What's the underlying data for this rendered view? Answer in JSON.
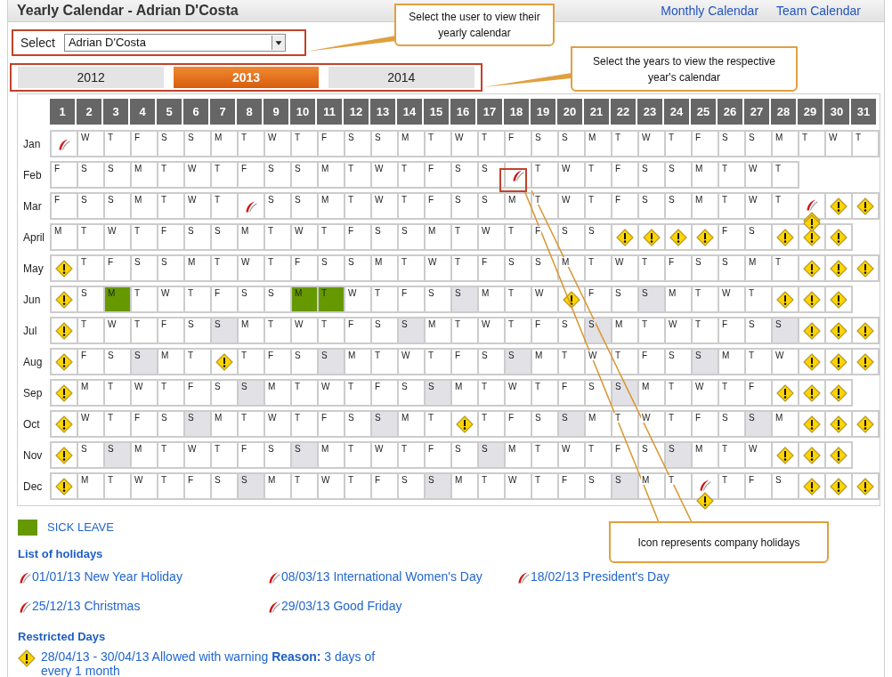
{
  "header": {
    "title": "Yearly Calendar - Adrian D'Costa",
    "links": [
      "Monthly Calendar",
      "Team Calendar"
    ]
  },
  "user_select": {
    "label": "Select",
    "value": "Adrian D'Costa"
  },
  "year_tabs": [
    {
      "label": "2012",
      "selected": false
    },
    {
      "label": "2013",
      "selected": true
    },
    {
      "label": "2014",
      "selected": false
    }
  ],
  "day_numbers": [
    "1",
    "2",
    "3",
    "4",
    "5",
    "6",
    "7",
    "8",
    "9",
    "10",
    "11",
    "12",
    "13",
    "14",
    "15",
    "16",
    "17",
    "18",
    "19",
    "20",
    "21",
    "22",
    "23",
    "24",
    "25",
    "26",
    "27",
    "28",
    "29",
    "30",
    "31"
  ],
  "months": [
    {
      "name": "Jan",
      "days": [
        {
          "kind": "holiday"
        },
        {
          "kind": "day",
          "label": "W"
        },
        {
          "kind": "day",
          "label": "T"
        },
        {
          "kind": "day",
          "label": "F"
        },
        {
          "kind": "day",
          "label": "S"
        },
        {
          "kind": "day",
          "label": "S"
        },
        {
          "kind": "day",
          "label": "M"
        },
        {
          "kind": "day",
          "label": "T"
        },
        {
          "kind": "day",
          "label": "W"
        },
        {
          "kind": "day",
          "label": "T"
        },
        {
          "kind": "day",
          "label": "F"
        },
        {
          "kind": "day",
          "label": "S"
        },
        {
          "kind": "day",
          "label": "S"
        },
        {
          "kind": "day",
          "label": "M"
        },
        {
          "kind": "day",
          "label": "T"
        },
        {
          "kind": "day",
          "label": "W"
        },
        {
          "kind": "day",
          "label": "T"
        },
        {
          "kind": "day",
          "label": "F"
        },
        {
          "kind": "day",
          "label": "S"
        },
        {
          "kind": "day",
          "label": "S"
        },
        {
          "kind": "day",
          "label": "M"
        },
        {
          "kind": "day",
          "label": "T"
        },
        {
          "kind": "day",
          "label": "W"
        },
        {
          "kind": "day",
          "label": "T"
        },
        {
          "kind": "day",
          "label": "F"
        },
        {
          "kind": "day",
          "label": "S"
        },
        {
          "kind": "day",
          "label": "S"
        },
        {
          "kind": "day",
          "label": "M"
        },
        {
          "kind": "day",
          "label": "T"
        },
        {
          "kind": "day",
          "label": "W"
        },
        {
          "kind": "day",
          "label": "T"
        }
      ]
    },
    {
      "name": "Feb",
      "days": [
        {
          "kind": "day",
          "label": "F"
        },
        {
          "kind": "day",
          "label": "S"
        },
        {
          "kind": "day",
          "label": "S"
        },
        {
          "kind": "day",
          "label": "M"
        },
        {
          "kind": "day",
          "label": "T"
        },
        {
          "kind": "day",
          "label": "W"
        },
        {
          "kind": "day",
          "label": "T"
        },
        {
          "kind": "day",
          "label": "F"
        },
        {
          "kind": "day",
          "label": "S"
        },
        {
          "kind": "day",
          "label": "S"
        },
        {
          "kind": "day",
          "label": "M"
        },
        {
          "kind": "day",
          "label": "T"
        },
        {
          "kind": "day",
          "label": "W"
        },
        {
          "kind": "day",
          "label": "T"
        },
        {
          "kind": "day",
          "label": "F"
        },
        {
          "kind": "day",
          "label": "S"
        },
        {
          "kind": "day",
          "label": "S"
        },
        {
          "kind": "holiday"
        },
        {
          "kind": "day",
          "label": "T"
        },
        {
          "kind": "day",
          "label": "W"
        },
        {
          "kind": "day",
          "label": "T"
        },
        {
          "kind": "day",
          "label": "F"
        },
        {
          "kind": "day",
          "label": "S"
        },
        {
          "kind": "day",
          "label": "S"
        },
        {
          "kind": "day",
          "label": "M"
        },
        {
          "kind": "day",
          "label": "T"
        },
        {
          "kind": "day",
          "label": "W"
        },
        {
          "kind": "day",
          "label": "T"
        }
      ]
    },
    {
      "name": "Mar",
      "days": [
        {
          "kind": "day",
          "label": "F"
        },
        {
          "kind": "day",
          "label": "S"
        },
        {
          "kind": "day",
          "label": "S"
        },
        {
          "kind": "day",
          "label": "M"
        },
        {
          "kind": "day",
          "label": "T"
        },
        {
          "kind": "day",
          "label": "W"
        },
        {
          "kind": "day",
          "label": "T"
        },
        {
          "kind": "holiday"
        },
        {
          "kind": "day",
          "label": "S"
        },
        {
          "kind": "day",
          "label": "S"
        },
        {
          "kind": "day",
          "label": "M"
        },
        {
          "kind": "day",
          "label": "T"
        },
        {
          "kind": "day",
          "label": "W"
        },
        {
          "kind": "day",
          "label": "T"
        },
        {
          "kind": "day",
          "label": "F"
        },
        {
          "kind": "day",
          "label": "S"
        },
        {
          "kind": "day",
          "label": "S"
        },
        {
          "kind": "day",
          "label": "M"
        },
        {
          "kind": "day",
          "label": "T"
        },
        {
          "kind": "day",
          "label": "W"
        },
        {
          "kind": "day",
          "label": "T"
        },
        {
          "kind": "day",
          "label": "F"
        },
        {
          "kind": "day",
          "label": "S"
        },
        {
          "kind": "day",
          "label": "S"
        },
        {
          "kind": "day",
          "label": "M"
        },
        {
          "kind": "day",
          "label": "T"
        },
        {
          "kind": "day",
          "label": "W"
        },
        {
          "kind": "day",
          "label": "T"
        },
        {
          "kind": "holiday_warning"
        },
        {
          "kind": "warning"
        },
        {
          "kind": "warning"
        }
      ]
    },
    {
      "name": "April",
      "days": [
        {
          "kind": "day",
          "label": "M"
        },
        {
          "kind": "day",
          "label": "T"
        },
        {
          "kind": "day",
          "label": "W"
        },
        {
          "kind": "day",
          "label": "T"
        },
        {
          "kind": "day",
          "label": "F"
        },
        {
          "kind": "day",
          "label": "S"
        },
        {
          "kind": "day",
          "label": "S"
        },
        {
          "kind": "day",
          "label": "M"
        },
        {
          "kind": "day",
          "label": "T"
        },
        {
          "kind": "day",
          "label": "W"
        },
        {
          "kind": "day",
          "label": "T"
        },
        {
          "kind": "day",
          "label": "F"
        },
        {
          "kind": "day",
          "label": "S"
        },
        {
          "kind": "day",
          "label": "S"
        },
        {
          "kind": "day",
          "label": "M"
        },
        {
          "kind": "day",
          "label": "T"
        },
        {
          "kind": "day",
          "label": "W"
        },
        {
          "kind": "day",
          "label": "T"
        },
        {
          "kind": "day",
          "label": "F"
        },
        {
          "kind": "day",
          "label": "S"
        },
        {
          "kind": "day",
          "label": "S"
        },
        {
          "kind": "warning"
        },
        {
          "kind": "warning"
        },
        {
          "kind": "warning"
        },
        {
          "kind": "warning"
        },
        {
          "kind": "day",
          "label": "F"
        },
        {
          "kind": "day",
          "label": "S"
        },
        {
          "kind": "warning"
        },
        {
          "kind": "double_warning"
        },
        {
          "kind": "warning"
        }
      ]
    },
    {
      "name": "May",
      "days": [
        {
          "kind": "warning"
        },
        {
          "kind": "day",
          "label": "T"
        },
        {
          "kind": "day",
          "label": "F"
        },
        {
          "kind": "day",
          "label": "S"
        },
        {
          "kind": "day",
          "label": "S"
        },
        {
          "kind": "day",
          "label": "M"
        },
        {
          "kind": "day",
          "label": "T"
        },
        {
          "kind": "day",
          "label": "W"
        },
        {
          "kind": "day",
          "label": "T"
        },
        {
          "kind": "day",
          "label": "F"
        },
        {
          "kind": "day",
          "label": "S"
        },
        {
          "kind": "day",
          "label": "S"
        },
        {
          "kind": "day",
          "label": "M"
        },
        {
          "kind": "day",
          "label": "T"
        },
        {
          "kind": "day",
          "label": "W"
        },
        {
          "kind": "day",
          "label": "T"
        },
        {
          "kind": "day",
          "label": "F"
        },
        {
          "kind": "day",
          "label": "S"
        },
        {
          "kind": "day",
          "label": "S"
        },
        {
          "kind": "day",
          "label": "M"
        },
        {
          "kind": "day",
          "label": "T"
        },
        {
          "kind": "day",
          "label": "W"
        },
        {
          "kind": "day",
          "label": "T"
        },
        {
          "kind": "day",
          "label": "F"
        },
        {
          "kind": "day",
          "label": "S"
        },
        {
          "kind": "day",
          "label": "S"
        },
        {
          "kind": "day",
          "label": "M"
        },
        {
          "kind": "day",
          "label": "T"
        },
        {
          "kind": "warning"
        },
        {
          "kind": "warning"
        },
        {
          "kind": "warning"
        }
      ]
    },
    {
      "name": "Jun",
      "days": [
        {
          "kind": "warning"
        },
        {
          "kind": "day",
          "label": "S"
        },
        {
          "kind": "sick",
          "label": "M"
        },
        {
          "kind": "day",
          "label": "T"
        },
        {
          "kind": "day",
          "label": "W"
        },
        {
          "kind": "day",
          "label": "T"
        },
        {
          "kind": "day",
          "label": "F"
        },
        {
          "kind": "day",
          "label": "S"
        },
        {
          "kind": "day",
          "label": "S"
        },
        {
          "kind": "sick",
          "label": "M"
        },
        {
          "kind": "sick",
          "label": "T"
        },
        {
          "kind": "day",
          "label": "W"
        },
        {
          "kind": "day",
          "label": "T"
        },
        {
          "kind": "day",
          "label": "F"
        },
        {
          "kind": "day",
          "label": "S"
        },
        {
          "kind": "weekend",
          "label": "S"
        },
        {
          "kind": "day",
          "label": "M"
        },
        {
          "kind": "day",
          "label": "T"
        },
        {
          "kind": "day",
          "label": "W"
        },
        {
          "kind": "warning"
        },
        {
          "kind": "day",
          "label": "F"
        },
        {
          "kind": "day",
          "label": "S"
        },
        {
          "kind": "weekend",
          "label": "S"
        },
        {
          "kind": "day",
          "label": "M"
        },
        {
          "kind": "day",
          "label": "T"
        },
        {
          "kind": "day",
          "label": "W"
        },
        {
          "kind": "day",
          "label": "T"
        },
        {
          "kind": "warning"
        },
        {
          "kind": "warning"
        },
        {
          "kind": "warning"
        }
      ]
    },
    {
      "name": "Jul",
      "days": [
        {
          "kind": "warning"
        },
        {
          "kind": "day",
          "label": "T"
        },
        {
          "kind": "day",
          "label": "W"
        },
        {
          "kind": "day",
          "label": "T"
        },
        {
          "kind": "day",
          "label": "F"
        },
        {
          "kind": "day",
          "label": "S"
        },
        {
          "kind": "weekend",
          "label": "S"
        },
        {
          "kind": "day",
          "label": "M"
        },
        {
          "kind": "day",
          "label": "T"
        },
        {
          "kind": "day",
          "label": "W"
        },
        {
          "kind": "day",
          "label": "T"
        },
        {
          "kind": "day",
          "label": "F"
        },
        {
          "kind": "day",
          "label": "S"
        },
        {
          "kind": "weekend",
          "label": "S"
        },
        {
          "kind": "day",
          "label": "M"
        },
        {
          "kind": "day",
          "label": "T"
        },
        {
          "kind": "day",
          "label": "W"
        },
        {
          "kind": "day",
          "label": "T"
        },
        {
          "kind": "day",
          "label": "F"
        },
        {
          "kind": "day",
          "label": "S"
        },
        {
          "kind": "weekend",
          "label": "S"
        },
        {
          "kind": "day",
          "label": "M"
        },
        {
          "kind": "day",
          "label": "T"
        },
        {
          "kind": "day",
          "label": "W"
        },
        {
          "kind": "day",
          "label": "T"
        },
        {
          "kind": "day",
          "label": "F"
        },
        {
          "kind": "day",
          "label": "S"
        },
        {
          "kind": "weekend",
          "label": "S"
        },
        {
          "kind": "warning"
        },
        {
          "kind": "warning"
        },
        {
          "kind": "warning"
        }
      ]
    },
    {
      "name": "Aug",
      "days": [
        {
          "kind": "warning"
        },
        {
          "kind": "day",
          "label": "F"
        },
        {
          "kind": "day",
          "label": "S"
        },
        {
          "kind": "weekend",
          "label": "S"
        },
        {
          "kind": "day",
          "label": "M"
        },
        {
          "kind": "day",
          "label": "T"
        },
        {
          "kind": "warning"
        },
        {
          "kind": "day",
          "label": "T"
        },
        {
          "kind": "day",
          "label": "F"
        },
        {
          "kind": "day",
          "label": "S"
        },
        {
          "kind": "weekend",
          "label": "S"
        },
        {
          "kind": "day",
          "label": "M"
        },
        {
          "kind": "day",
          "label": "T"
        },
        {
          "kind": "day",
          "label": "W"
        },
        {
          "kind": "day",
          "label": "T"
        },
        {
          "kind": "day",
          "label": "F"
        },
        {
          "kind": "day",
          "label": "S"
        },
        {
          "kind": "weekend",
          "label": "S"
        },
        {
          "kind": "day",
          "label": "M"
        },
        {
          "kind": "day",
          "label": "T"
        },
        {
          "kind": "day",
          "label": "W"
        },
        {
          "kind": "day",
          "label": "T"
        },
        {
          "kind": "day",
          "label": "F"
        },
        {
          "kind": "day",
          "label": "S"
        },
        {
          "kind": "weekend",
          "label": "S"
        },
        {
          "kind": "day",
          "label": "M"
        },
        {
          "kind": "day",
          "label": "T"
        },
        {
          "kind": "day",
          "label": "W"
        },
        {
          "kind": "warning"
        },
        {
          "kind": "warning"
        },
        {
          "kind": "warning"
        }
      ]
    },
    {
      "name": "Sep",
      "days": [
        {
          "kind": "warning"
        },
        {
          "kind": "day",
          "label": "M"
        },
        {
          "kind": "day",
          "label": "T"
        },
        {
          "kind": "day",
          "label": "W"
        },
        {
          "kind": "day",
          "label": "T"
        },
        {
          "kind": "day",
          "label": "F"
        },
        {
          "kind": "day",
          "label": "S"
        },
        {
          "kind": "weekend",
          "label": "S"
        },
        {
          "kind": "day",
          "label": "M"
        },
        {
          "kind": "day",
          "label": "T"
        },
        {
          "kind": "day",
          "label": "W"
        },
        {
          "kind": "day",
          "label": "T"
        },
        {
          "kind": "day",
          "label": "F"
        },
        {
          "kind": "day",
          "label": "S"
        },
        {
          "kind": "weekend",
          "label": "S"
        },
        {
          "kind": "day",
          "label": "M"
        },
        {
          "kind": "day",
          "label": "T"
        },
        {
          "kind": "day",
          "label": "W"
        },
        {
          "kind": "day",
          "label": "T"
        },
        {
          "kind": "day",
          "label": "F"
        },
        {
          "kind": "day",
          "label": "S"
        },
        {
          "kind": "weekend",
          "label": "S"
        },
        {
          "kind": "day",
          "label": "M"
        },
        {
          "kind": "day",
          "label": "T"
        },
        {
          "kind": "day",
          "label": "W"
        },
        {
          "kind": "day",
          "label": "T"
        },
        {
          "kind": "day",
          "label": "F"
        },
        {
          "kind": "warning"
        },
        {
          "kind": "warning"
        },
        {
          "kind": "warning"
        }
      ]
    },
    {
      "name": "Oct",
      "days": [
        {
          "kind": "warning"
        },
        {
          "kind": "day",
          "label": "W"
        },
        {
          "kind": "day",
          "label": "T"
        },
        {
          "kind": "day",
          "label": "F"
        },
        {
          "kind": "day",
          "label": "S"
        },
        {
          "kind": "weekend",
          "label": "S"
        },
        {
          "kind": "day",
          "label": "M"
        },
        {
          "kind": "day",
          "label": "T"
        },
        {
          "kind": "day",
          "label": "W"
        },
        {
          "kind": "day",
          "label": "T"
        },
        {
          "kind": "day",
          "label": "F"
        },
        {
          "kind": "day",
          "label": "S"
        },
        {
          "kind": "weekend",
          "label": "S"
        },
        {
          "kind": "day",
          "label": "M"
        },
        {
          "kind": "day",
          "label": "T"
        },
        {
          "kind": "warning"
        },
        {
          "kind": "day",
          "label": "T"
        },
        {
          "kind": "day",
          "label": "F"
        },
        {
          "kind": "day",
          "label": "S"
        },
        {
          "kind": "weekend",
          "label": "S"
        },
        {
          "kind": "day",
          "label": "M"
        },
        {
          "kind": "day",
          "label": "T"
        },
        {
          "kind": "day",
          "label": "W"
        },
        {
          "kind": "day",
          "label": "T"
        },
        {
          "kind": "day",
          "label": "F"
        },
        {
          "kind": "day",
          "label": "S"
        },
        {
          "kind": "weekend",
          "label": "S"
        },
        {
          "kind": "day",
          "label": "M"
        },
        {
          "kind": "warning"
        },
        {
          "kind": "warning"
        },
        {
          "kind": "warning"
        }
      ]
    },
    {
      "name": "Nov",
      "days": [
        {
          "kind": "warning"
        },
        {
          "kind": "day",
          "label": "S"
        },
        {
          "kind": "weekend",
          "label": "S"
        },
        {
          "kind": "day",
          "label": "M"
        },
        {
          "kind": "day",
          "label": "T"
        },
        {
          "kind": "day",
          "label": "W"
        },
        {
          "kind": "day",
          "label": "T"
        },
        {
          "kind": "day",
          "label": "F"
        },
        {
          "kind": "day",
          "label": "S"
        },
        {
          "kind": "weekend",
          "label": "S"
        },
        {
          "kind": "day",
          "label": "M"
        },
        {
          "kind": "day",
          "label": "T"
        },
        {
          "kind": "day",
          "label": "W"
        },
        {
          "kind": "day",
          "label": "T"
        },
        {
          "kind": "day",
          "label": "F"
        },
        {
          "kind": "day",
          "label": "S"
        },
        {
          "kind": "weekend",
          "label": "S"
        },
        {
          "kind": "day",
          "label": "M"
        },
        {
          "kind": "day",
          "label": "T"
        },
        {
          "kind": "day",
          "label": "W"
        },
        {
          "kind": "day",
          "label": "T"
        },
        {
          "kind": "day",
          "label": "F"
        },
        {
          "kind": "day",
          "label": "S"
        },
        {
          "kind": "weekend",
          "label": "S"
        },
        {
          "kind": "day",
          "label": "M"
        },
        {
          "kind": "day",
          "label": "T"
        },
        {
          "kind": "day",
          "label": "W"
        },
        {
          "kind": "warning"
        },
        {
          "kind": "warning"
        },
        {
          "kind": "warning"
        }
      ]
    },
    {
      "name": "Dec",
      "days": [
        {
          "kind": "warning"
        },
        {
          "kind": "day",
          "label": "M"
        },
        {
          "kind": "day",
          "label": "T"
        },
        {
          "kind": "day",
          "label": "W"
        },
        {
          "kind": "day",
          "label": "T"
        },
        {
          "kind": "day",
          "label": "F"
        },
        {
          "kind": "day",
          "label": "S"
        },
        {
          "kind": "weekend",
          "label": "S"
        },
        {
          "kind": "day",
          "label": "M"
        },
        {
          "kind": "day",
          "label": "T"
        },
        {
          "kind": "day",
          "label": "W"
        },
        {
          "kind": "day",
          "label": "T"
        },
        {
          "kind": "day",
          "label": "F"
        },
        {
          "kind": "day",
          "label": "S"
        },
        {
          "kind": "weekend",
          "label": "S"
        },
        {
          "kind": "day",
          "label": "M"
        },
        {
          "kind": "day",
          "label": "T"
        },
        {
          "kind": "day",
          "label": "W"
        },
        {
          "kind": "day",
          "label": "T"
        },
        {
          "kind": "day",
          "label": "F"
        },
        {
          "kind": "day",
          "label": "S"
        },
        {
          "kind": "weekend",
          "label": "S"
        },
        {
          "kind": "day",
          "label": "M"
        },
        {
          "kind": "day",
          "label": "T"
        },
        {
          "kind": "holiday_warning"
        },
        {
          "kind": "day",
          "label": "T"
        },
        {
          "kind": "day",
          "label": "F"
        },
        {
          "kind": "day",
          "label": "S"
        },
        {
          "kind": "warning"
        },
        {
          "kind": "warning"
        },
        {
          "kind": "warning"
        }
      ]
    }
  ],
  "legend": {
    "label": "SICK LEAVE"
  },
  "holidays": {
    "title": "List of holidays",
    "items": [
      "01/01/13 New Year Holiday",
      "08/03/13 International Women's Day",
      "18/02/13 President's Day",
      "25/12/13 Christmas",
      "29/03/13 Good Friday"
    ]
  },
  "restricted_days": {
    "title": "Restricted Days",
    "items": [
      "28/04/13 - 30/04/13 Allowed with warning **Reason:** 3 days of every 1 month"
    ]
  },
  "annotations": [
    "Select the user to view their yearly calendar",
    "Select the years to view the respective year's calendar",
    "Icon represents company holidays"
  ]
}
